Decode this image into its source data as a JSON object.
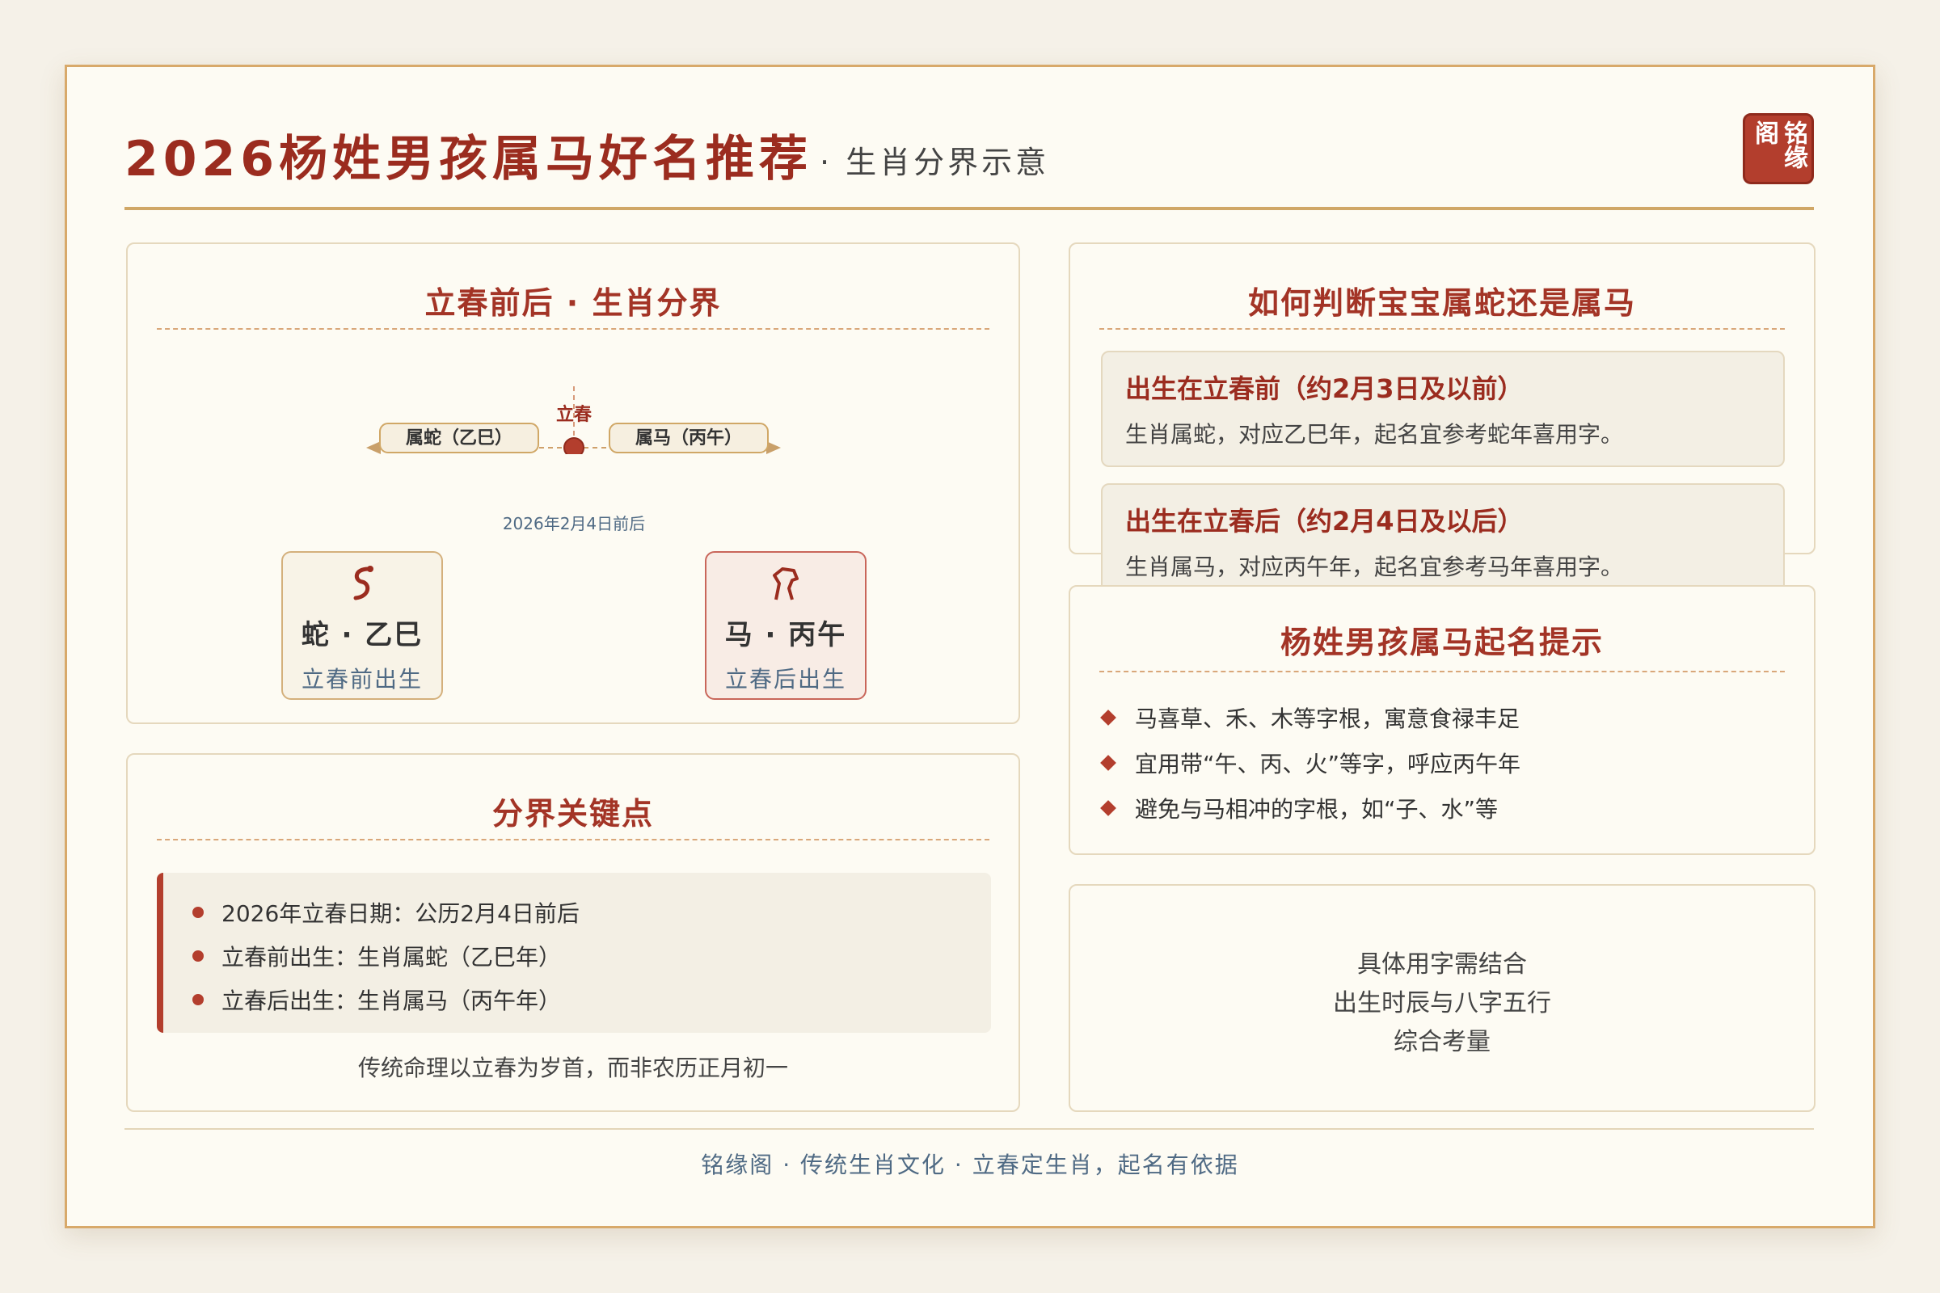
{
  "header": {
    "title": "2026杨姓男孩属马好名推荐",
    "subtitle": "· 生肖分界示意",
    "seal_col1": "铭缘",
    "seal_col2": "阁"
  },
  "boundary": {
    "title": "立春前后 · 生肖分界",
    "left_label": "属蛇（乙巳）",
    "right_label": "属马（丙午）",
    "marker_label": "立春",
    "date_label": "2026年2月4日前后",
    "snake": {
      "icon": "snake-icon",
      "name": "蛇 · 乙巳",
      "desc": "立春前出生"
    },
    "horse": {
      "icon": "horse-icon",
      "name": "马 · 丙午",
      "desc": "立春后出生"
    }
  },
  "keypoints": {
    "title": "分界关键点",
    "items": [
      "2026年立春日期：公历2月4日前后",
      "立春前出生：生肖属蛇（乙巳年）",
      "立春后出生：生肖属马（丙午年）"
    ],
    "note": "传统命理以立春为岁首，而非农历正月初一"
  },
  "judge": {
    "title": "如何判断宝宝属蛇还是属马",
    "cases": [
      {
        "heading": "出生在立春前（约2月3日及以前）",
        "text": "生肖属蛇，对应乙巳年，起名宜参考蛇年喜用字。"
      },
      {
        "heading": "出生在立春后（约2月4日及以后）",
        "text": "生肖属马，对应丙午年，起名宜参考马年喜用字。"
      }
    ]
  },
  "tips": {
    "title": "杨姓男孩属马起名提示",
    "items": [
      "马喜草、禾、木等字根，寓意食禄丰足",
      "宜用带“午、丙、火”等字，呼应丙午年",
      "避免与马相冲的字根，如“子、水”等"
    ]
  },
  "closing": {
    "line1": "具体用字需结合",
    "line2": "出生时辰与八字五行",
    "line3": "综合考量"
  },
  "footer": "铭缘阁 · 传统生肖文化 · 立春定生肖，起名有依据",
  "colors": {
    "accent": "#9b2c1f",
    "gold": "#d0a766",
    "muted_blue": "#4f6a84",
    "background": "#fdfbf3"
  }
}
